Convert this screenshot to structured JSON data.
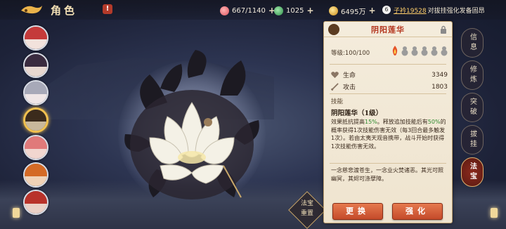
{
  "header": {
    "title": "角色",
    "stamina": "667/1140",
    "jade": "1025",
    "gold": "6495万",
    "ticker_badge": "6",
    "ticker_user": "子衿19528",
    "ticker_text": "对拔挂强化发备固昂"
  },
  "panel": {
    "title": "阴阳莲华",
    "level_label": "等级:",
    "level_value": "100/100",
    "stats": [
      {
        "label": "生命",
        "value": "3349"
      },
      {
        "label": "攻击",
        "value": "1803"
      }
    ],
    "skill_header": "技能",
    "skill_name": "阴阳莲华（1级）",
    "skill_desc_1": "效果抵抗提高",
    "skill_desc_pct1": "15%",
    "skill_desc_2": "。释放追加技能后有",
    "skill_desc_pct2": "50%",
    "skill_desc_3": "的概率获得1次技能伤害无效（每3回合最多触发1次）。若由太夷天观音携带，战斗开始时获得1次技能伤害无效。",
    "flavor": "一念慈悲渡苍生，一念业火焚诸恶。其光可照幽冥，其烬可涤孽障。",
    "btn_swap": "更换",
    "btn_upgrade": "强化"
  },
  "tabs": [
    "信息",
    "修炼",
    "突破",
    "拔挂",
    "法宝"
  ],
  "active_tab": "法宝",
  "reset_label_1": "法宝",
  "reset_label_2": "重置",
  "colors": {
    "accent": "#c44a2a",
    "title_red": "#b3341c",
    "gold": "#f2c14e"
  }
}
